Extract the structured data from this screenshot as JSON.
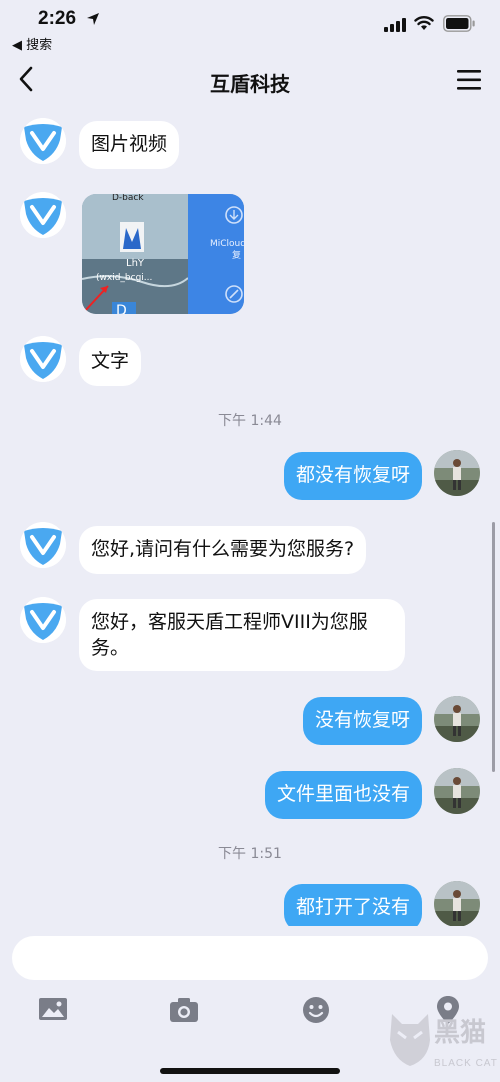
{
  "status_bar": {
    "time": "2:26",
    "back_app": "◀ 搜索"
  },
  "nav": {
    "title": "互盾科技"
  },
  "messages": [
    {
      "side": "left",
      "text": "图片视频"
    },
    {
      "side": "left",
      "type": "image",
      "image_text": [
        "D-back",
        "LhY",
        "(wxid_bcgi...",
        "MiCloud",
        "复"
      ]
    },
    {
      "side": "left",
      "text": "文字"
    },
    {
      "type": "time",
      "text": "下午 1:44"
    },
    {
      "side": "right",
      "text": "都没有恢复呀"
    },
    {
      "side": "left",
      "text": "您好,请问有什么需要为您服务?"
    },
    {
      "side": "left",
      "text": "您好，客服天盾工程师VIII为您服务。",
      "lines": [
        "您好，客服天盾工程师VIII为您服",
        "务。"
      ]
    },
    {
      "side": "right",
      "text": "没有恢复呀"
    },
    {
      "side": "right",
      "text": "文件里面也没有"
    },
    {
      "type": "time",
      "text": "下午 1:51"
    },
    {
      "side": "right",
      "text": "都打开了没有"
    }
  ],
  "input": {
    "placeholder": ""
  },
  "toolbar": [
    "image-icon",
    "camera-icon",
    "emoji-icon",
    "location-icon"
  ],
  "watermark": {
    "text": "黑猫",
    "sub": "BLACK CAT"
  },
  "colors": {
    "accent": "#3ea7f4",
    "background": "#ecedf6",
    "agent_logo": "#4aa8f0"
  }
}
